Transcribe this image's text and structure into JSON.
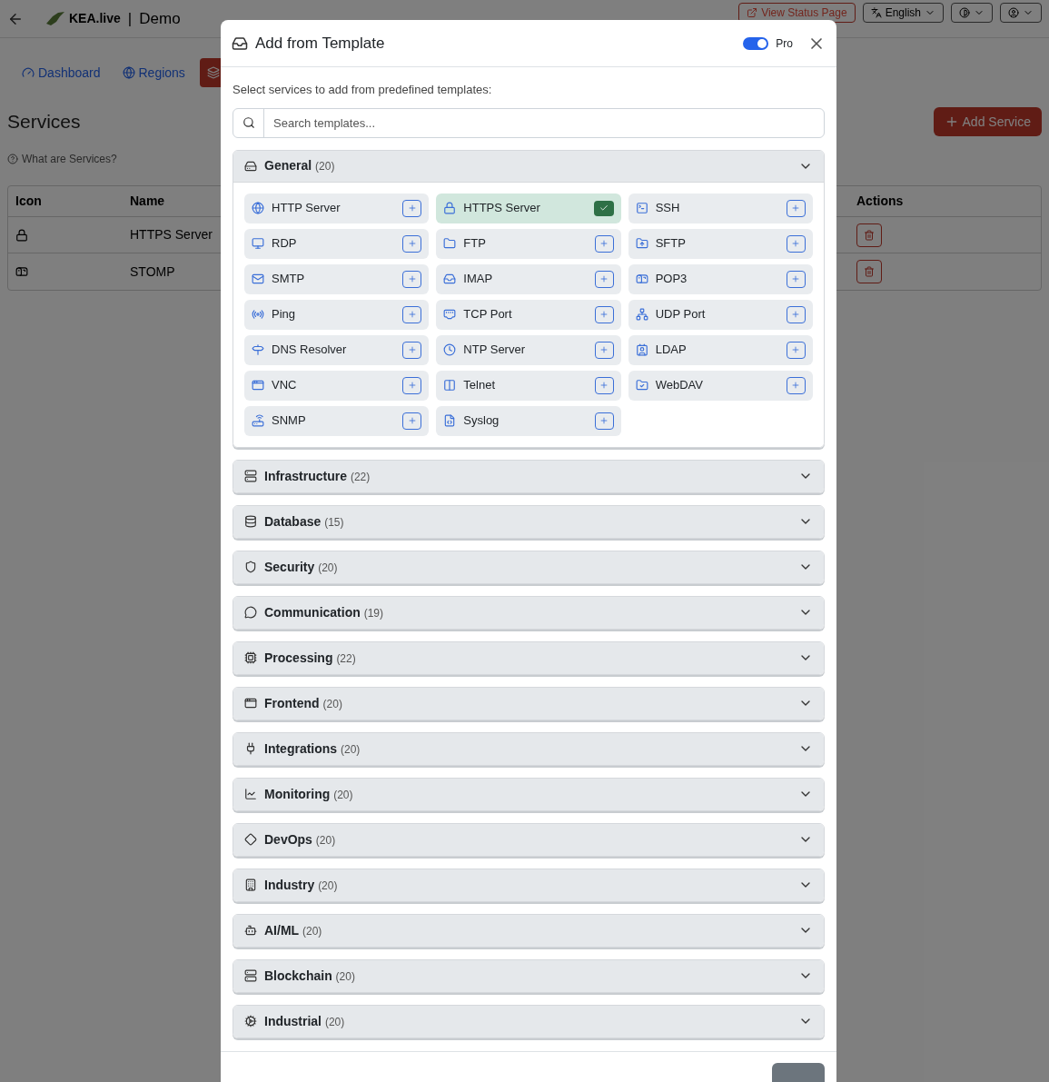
{
  "header": {
    "brand": "KEA.live",
    "separator": "|",
    "project": "Demo",
    "status_button": "View Status Page",
    "language": "English"
  },
  "nav": [
    {
      "label": "Dashboard",
      "selected": false
    },
    {
      "label": "Regions",
      "selected": false
    },
    {
      "selected": true
    }
  ],
  "page": {
    "title": "Services",
    "help_link": "What are Services?",
    "add_button": "Add Service"
  },
  "table": {
    "columns": [
      "Icon",
      "Name",
      "Actions"
    ],
    "rows": [
      {
        "name": "HTTPS Server"
      },
      {
        "name": "STOMP"
      }
    ]
  },
  "modal": {
    "title": "Add from Template",
    "pro": {
      "label": "Pro",
      "on": true
    },
    "instruction": "Select services to add from predefined templates:",
    "search": {
      "placeholder": "Search templates..."
    },
    "categories": [
      {
        "name": "General",
        "count": "(20)",
        "expanded": true,
        "items": [
          {
            "name": "HTTP Server",
            "selected": false
          },
          {
            "name": "HTTPS Server",
            "selected": true
          },
          {
            "name": "SSH",
            "selected": false
          },
          {
            "name": "RDP",
            "selected": false
          },
          {
            "name": "FTP",
            "selected": false
          },
          {
            "name": "SFTP",
            "selected": false
          },
          {
            "name": "SMTP",
            "selected": false
          },
          {
            "name": "IMAP",
            "selected": false
          },
          {
            "name": "POP3",
            "selected": false
          },
          {
            "name": "Ping",
            "selected": false
          },
          {
            "name": "TCP Port",
            "selected": false
          },
          {
            "name": "UDP Port",
            "selected": false
          },
          {
            "name": "DNS Resolver",
            "selected": false
          },
          {
            "name": "NTP Server",
            "selected": false
          },
          {
            "name": "LDAP",
            "selected": false
          },
          {
            "name": "VNC",
            "selected": false
          },
          {
            "name": "Telnet",
            "selected": false
          },
          {
            "name": "WebDAV",
            "selected": false
          },
          {
            "name": "SNMP",
            "selected": false
          },
          {
            "name": "Syslog",
            "selected": false
          }
        ]
      },
      {
        "name": "Infrastructure",
        "count": "(22)",
        "expanded": false
      },
      {
        "name": "Database",
        "count": "(15)",
        "expanded": false
      },
      {
        "name": "Security",
        "count": "(20)",
        "expanded": false
      },
      {
        "name": "Communication",
        "count": "(19)",
        "expanded": false
      },
      {
        "name": "Processing",
        "count": "(22)",
        "expanded": false
      },
      {
        "name": "Frontend",
        "count": "(20)",
        "expanded": false
      },
      {
        "name": "Integrations",
        "count": "(20)",
        "expanded": false
      },
      {
        "name": "Monitoring",
        "count": "(20)",
        "expanded": false
      },
      {
        "name": "DevOps",
        "count": "(20)",
        "expanded": false
      },
      {
        "name": "Industry",
        "count": "(20)",
        "expanded": false
      },
      {
        "name": "AI/ML",
        "count": "(20)",
        "expanded": false
      },
      {
        "name": "Blockchain",
        "count": "(20)",
        "expanded": false
      },
      {
        "name": "Industrial",
        "count": "(20)",
        "expanded": false
      }
    ]
  }
}
